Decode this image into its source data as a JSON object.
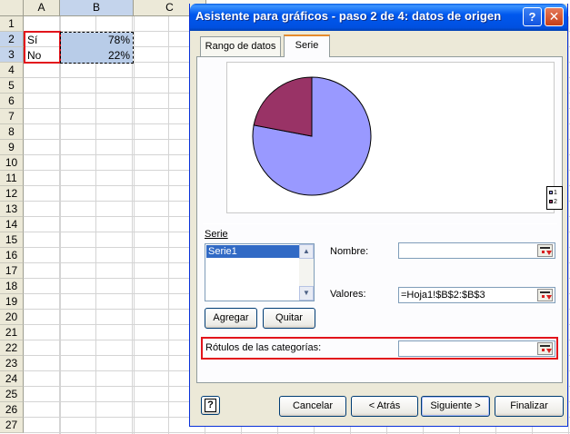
{
  "sheet": {
    "columns": [
      "A",
      "B",
      "C"
    ],
    "rows": [
      "1",
      "2",
      "3",
      "4",
      "5",
      "6",
      "7",
      "8",
      "9",
      "10",
      "11",
      "12",
      "13",
      "14",
      "15",
      "16",
      "17",
      "18",
      "19",
      "20",
      "21",
      "22",
      "23",
      "24",
      "25",
      "26",
      "27"
    ],
    "cells": {
      "a2": "Sí",
      "b2": "78%",
      "a3": "No",
      "b3": "22%"
    }
  },
  "dialog": {
    "title": "Asistente para gráficos - paso 2 de 4: datos de origen",
    "help_glyph": "?",
    "close_glyph": "✕",
    "tabs": [
      {
        "label": "Rango de datos"
      },
      {
        "label": "Serie"
      }
    ],
    "chart_data": {
      "type": "pie",
      "categories": [
        "1",
        "2"
      ],
      "values": [
        78,
        22
      ],
      "colors": [
        "#9999ff",
        "#993366"
      ],
      "legend": "right",
      "legend_entries": [
        "1",
        "2"
      ]
    },
    "series_section": {
      "label": "Serie",
      "items": [
        "Serie1"
      ]
    },
    "nombre_label": "Nombre:",
    "nombre_value": "",
    "valores_label": "Valores:",
    "valores_value": "=Hoja1!$B$2:$B$3",
    "agregar_label": "Agregar",
    "quitar_label": "Quitar",
    "rotulos_label": "Rótulos de las categorías:",
    "rotulos_value": "",
    "help_icon_glyph": "?",
    "buttons": {
      "cancel": "Cancelar",
      "back": "< Atrás",
      "next": "Siguiente >",
      "finish": "Finalizar"
    },
    "accent_colors": {
      "title_bar": "#0058ee",
      "highlight_box": "#e2141c",
      "selection": "#316ac5"
    }
  }
}
